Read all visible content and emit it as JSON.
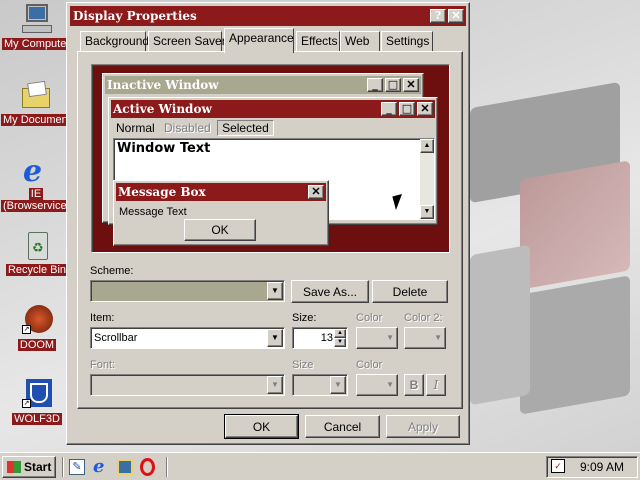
{
  "desktop": {
    "icons": [
      {
        "label": "My Computer",
        "icon": "computer-icon"
      },
      {
        "label": "My Documents",
        "icon": "folder-icon"
      },
      {
        "label": "IE",
        "label2": "(Browservice)",
        "icon": "ie-icon"
      },
      {
        "label": "Recycle Bin",
        "icon": "recycle-bin-icon"
      },
      {
        "label": "DOOM",
        "icon": "doom-icon"
      },
      {
        "label": "WOLF3D",
        "icon": "wolf3d-icon"
      }
    ]
  },
  "dialog": {
    "title": "Display Properties",
    "help_label": "?",
    "close_label": "✕",
    "tabs": [
      "Background",
      "Screen Saver",
      "Appearance",
      "Effects",
      "Web",
      "Settings"
    ],
    "active_tab": "Appearance",
    "preview": {
      "inactive_title": "Inactive Window",
      "active_title": "Active Window",
      "menu_normal": "Normal",
      "menu_disabled": "Disabled",
      "menu_selected": "Selected",
      "window_text": "Window Text",
      "message_title": "Message Box",
      "message_text": "Message Text",
      "ok_label": "OK"
    },
    "scheme_label": "Scheme:",
    "scheme_value": "",
    "save_as_label": "Save As...",
    "delete_label": "Delete",
    "item_label": "Item:",
    "item_value": "Scrollbar",
    "size_label": "Size:",
    "size_value": "13",
    "color_label": "Color",
    "color2_label": "Color 2:",
    "font_label": "Font:",
    "font_size_label": "Size",
    "font_color_label": "Color",
    "bold_label": "B",
    "italic_label": "I",
    "ok_label": "OK",
    "cancel_label": "Cancel",
    "apply_label": "Apply"
  },
  "taskbar": {
    "start_label": "Start",
    "clock": "9:09 AM",
    "quicklaunch": [
      "edit-icon",
      "ie-icon",
      "network-icon",
      "opera-icon"
    ]
  },
  "colors": {
    "accent": "#8c1a1a",
    "inactive_title": "#a8a890",
    "face": "#d4d0c8",
    "preview_bg": "#6e0f0f"
  }
}
